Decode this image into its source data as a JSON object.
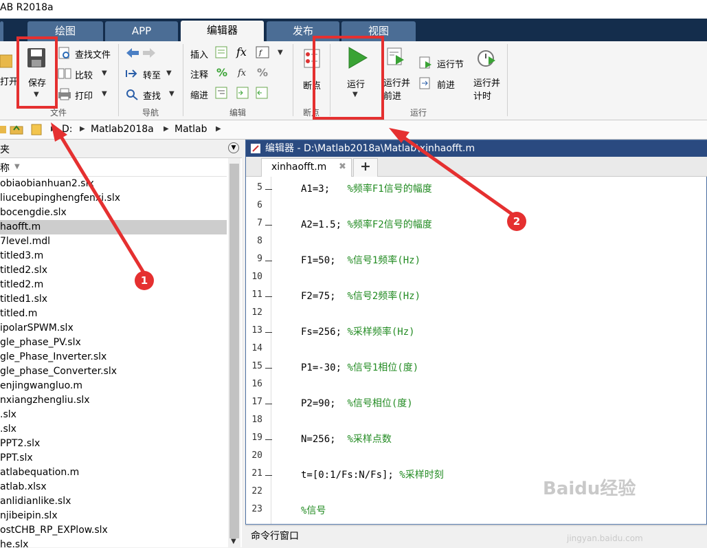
{
  "window": {
    "title": "AB R2018a"
  },
  "tabs": [
    {
      "label": ""
    },
    {
      "label": "绘图"
    },
    {
      "label": "APP"
    },
    {
      "label": "编辑器"
    },
    {
      "label": "发布"
    },
    {
      "label": "视图"
    }
  ],
  "toolstrip": {
    "file": {
      "open_label": "打开",
      "save_label": "保存",
      "find_files_label": "查找文件",
      "compare_label": "比较",
      "print_label": "打印",
      "group_label": "文件"
    },
    "navigate": {
      "goto_label": "转至",
      "find_label": "查找",
      "group_label": "导航"
    },
    "edit": {
      "insert_label": "插入",
      "comment_label": "注释",
      "indent_label": "缩进",
      "fx_label": "fx",
      "group_label": "编辑"
    },
    "breakpoints": {
      "label": "断点",
      "group_label": "断点"
    },
    "run": {
      "run_label": "运行",
      "run_advance_label": "运行并\n前进",
      "run_section_label": "运行节",
      "advance_label": "前进",
      "run_time_label": "运行并\n计时",
      "group_label": "运行"
    }
  },
  "path": {
    "segments": [
      "D:",
      "Matlab2018a",
      "Matlab"
    ]
  },
  "current_folder": {
    "title": "夹",
    "column_header": "称",
    "files": [
      "obiaobianhuan2.slx",
      "liucebupinghengfenxi.slx",
      "bocengdie.slx",
      "haofft.m",
      "7level.mdl",
      "titled3.m",
      "titled2.slx",
      "titled2.m",
      "titled1.slx",
      "titled.m",
      "ipolarSPWM.slx",
      "gle_phase_PV.slx",
      "gle_Phase_Inverter.slx",
      "gle_phase_Converter.slx",
      "enjingwangluo.m",
      "nxiangzhengliu.slx",
      ".slx",
      ".slx",
      "PPT2.slx",
      "PPT.slx",
      "atlabequation.m",
      "atlab.xlsx",
      "anlidianlike.slx",
      "njibeipin.slx",
      "ostCHB_RP_EXPlow.slx",
      "he.slx"
    ],
    "selected_index": 3
  },
  "editor": {
    "title": "编辑器 - D:\\Matlab2018a\\Matlab\\xinhaofft.m",
    "active_tab": "xinhaofft.m",
    "add_tab": "+",
    "lines": [
      {
        "num": "5",
        "code": "A1=3;   ",
        "comment": "%频率F1信号的幅度",
        "dash": true
      },
      {
        "num": "6",
        "code": "",
        "comment": "",
        "dash": false
      },
      {
        "num": "7",
        "code": "A2=1.5; ",
        "comment": "%频率F2信号的幅度",
        "dash": true
      },
      {
        "num": "8",
        "code": "",
        "comment": "",
        "dash": false
      },
      {
        "num": "9",
        "code": "F1=50;  ",
        "comment": "%信号1频率(Hz)",
        "dash": true
      },
      {
        "num": "10",
        "code": "",
        "comment": "",
        "dash": false
      },
      {
        "num": "11",
        "code": "F2=75;  ",
        "comment": "%信号2频率(Hz)",
        "dash": true
      },
      {
        "num": "12",
        "code": "",
        "comment": "",
        "dash": false
      },
      {
        "num": "13",
        "code": "Fs=256; ",
        "comment": "%采样频率(Hz)",
        "dash": true
      },
      {
        "num": "14",
        "code": "",
        "comment": "",
        "dash": false
      },
      {
        "num": "15",
        "code": "P1=-30; ",
        "comment": "%信号1相位(度)",
        "dash": true
      },
      {
        "num": "16",
        "code": "",
        "comment": "",
        "dash": false
      },
      {
        "num": "17",
        "code": "P2=90;  ",
        "comment": "%信号相位(度)",
        "dash": true
      },
      {
        "num": "18",
        "code": "",
        "comment": "",
        "dash": false
      },
      {
        "num": "19",
        "code": "N=256;  ",
        "comment": "%采样点数",
        "dash": true
      },
      {
        "num": "20",
        "code": "",
        "comment": "",
        "dash": false
      },
      {
        "num": "21",
        "code": "t=[0:1/Fs:N/Fs]; ",
        "comment": "%采样时刻",
        "dash": true
      },
      {
        "num": "22",
        "code": "",
        "comment": "",
        "dash": false
      },
      {
        "num": "23",
        "code": "",
        "comment": "%信号",
        "dash": false
      }
    ]
  },
  "command_window": {
    "title": "命令行窗口"
  },
  "annotations": [
    {
      "label": "1"
    },
    {
      "label": "2"
    }
  ],
  "watermark": {
    "text": "Baidu经验",
    "url": "jingyan.baidu.com"
  },
  "colors": {
    "accent_red": "#e53030",
    "run_green": "#3aa335",
    "comment_green": "#228b22",
    "tab_dark": "#142d4c"
  }
}
